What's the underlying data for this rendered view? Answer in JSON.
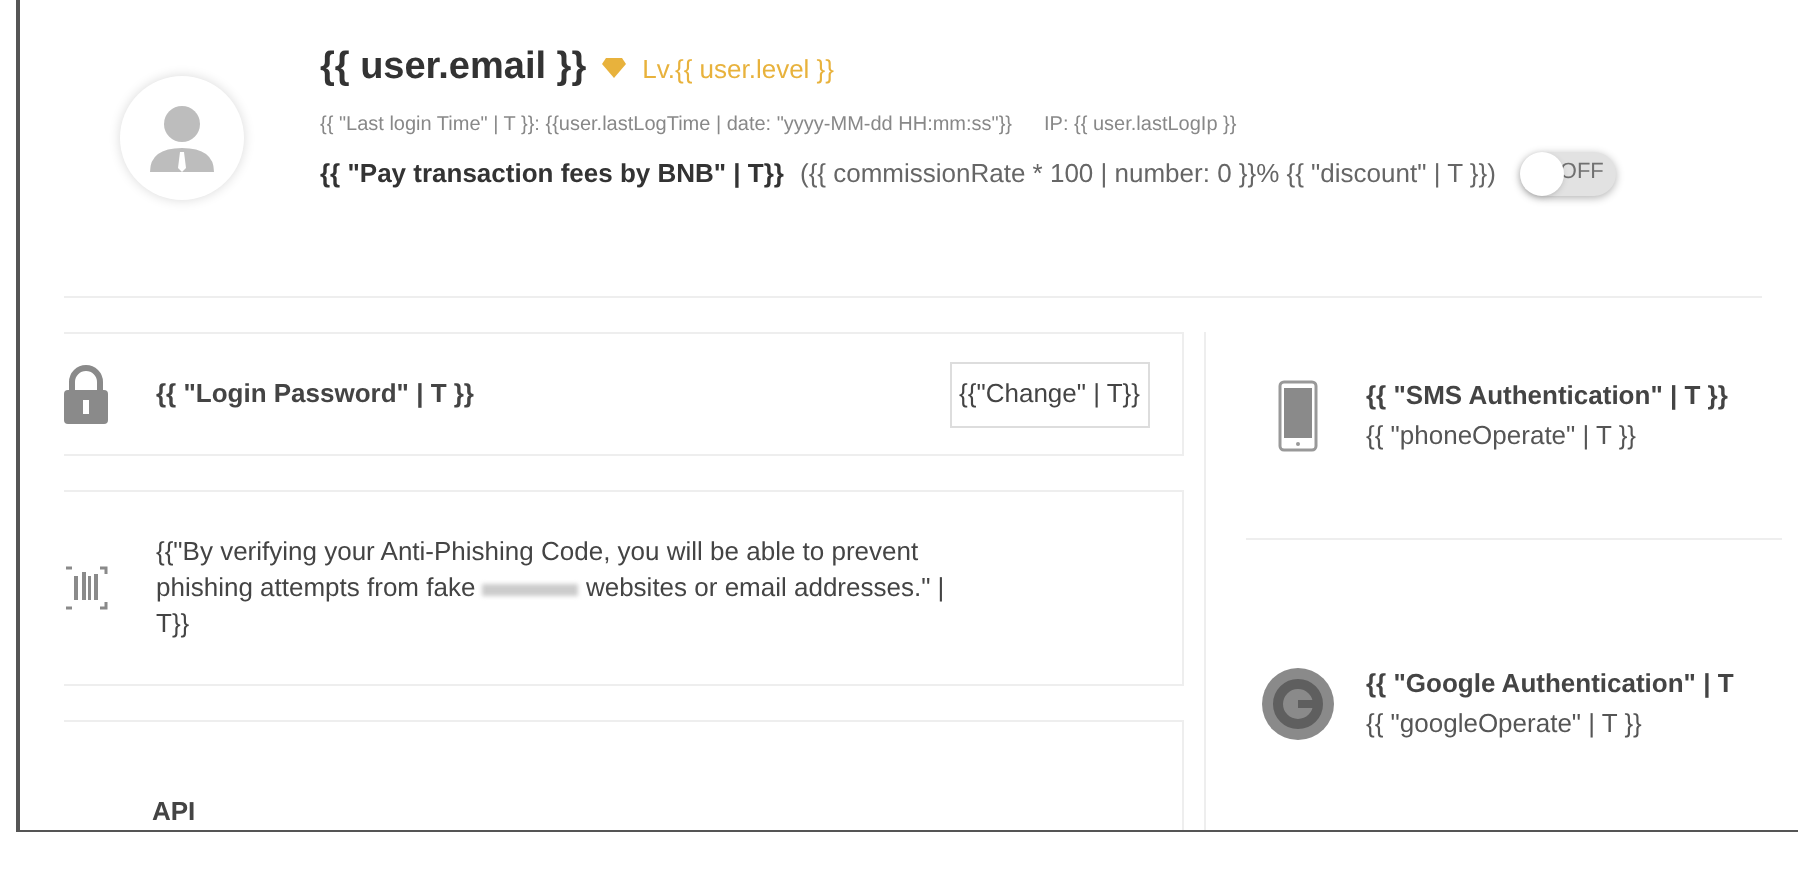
{
  "profile": {
    "email": "{{ user.email }}",
    "level": "Lv.{{ user.level }}",
    "last_login": "{{ \"Last login Time\" | T }}: {{user.lastLogTime | date: \"yyyy-MM-dd HH:mm:ss\"}}",
    "ip": "IP: {{ user.lastLogIp }}",
    "fee_label": "{{ \"Pay transaction fees by BNB\" | T}}",
    "fee_detail": "({{ commissionRate * 100 | number: 0 }}% {{ \"discount\" | T }})",
    "fee_toggle": {
      "on": false,
      "label": "OFF"
    }
  },
  "left_cards": [
    {
      "kind": "password",
      "title": "{{ \"Login Password\" | T }}",
      "button": "{{\"Change\" | T}}"
    },
    {
      "kind": "phishing",
      "text_before": "{{\"By verifying your Anti-Phishing Code, you will be able to prevent phishing attempts from fake",
      "text_after": "websites or email addresses.\" | T}}"
    },
    {
      "kind": "api",
      "title": "API"
    }
  ],
  "right_items": [
    {
      "kind": "sms",
      "title": "{{ \"SMS Authentication\" | T }}",
      "subtitle": "{{ \"phoneOperate\" | T }}"
    },
    {
      "kind": "google",
      "title": "{{ \"Google Authentication\" | T",
      "subtitle": "{{ \"googleOperate\" | T }}"
    }
  ]
}
